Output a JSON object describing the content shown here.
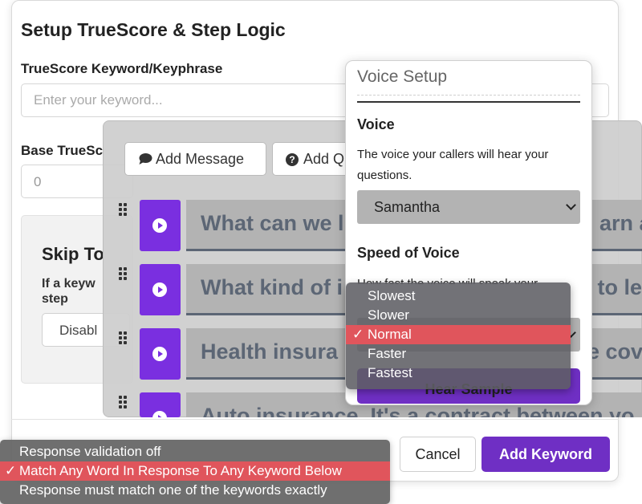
{
  "modal": {
    "title": "Setup TrueScore & Step Logic",
    "keyword_label": "TrueScore Keyword/Keyphrase",
    "keyword_placeholder": "Enter your keyword...",
    "base_label": "Base TrueSc",
    "base_value": "0",
    "skip_title": "Skip To",
    "skip_desc": "If a keyw step",
    "skip_select": "Disabl"
  },
  "footer": {
    "cancel_label": "Cancel",
    "add_keyword_label": "Add Keyword"
  },
  "validation_menu": {
    "options": [
      "Response validation off",
      "Match Any Word In Response To Any Keyword Below",
      "Response must match one of the keywords exactly"
    ],
    "selected": "Match Any Word In Response To Any Keyword Below",
    "check": "✓"
  },
  "messages_panel": {
    "add_message_label": "Add Message",
    "add_question_label": "Add Q",
    "question_icon": "?",
    "rows": [
      "What can we l",
      "What kind of i",
      "Health insura",
      "Auto insurance. It's a contract between yo"
    ],
    "row_suffixes": [
      "arn a",
      "e to le",
      "e cov",
      ""
    ]
  },
  "voice_setup": {
    "title": "Voice Setup",
    "voice_label": "Voice",
    "voice_desc": "The voice your callers will hear your questions.",
    "voice_selected": "Samantha",
    "speed_label": "Speed of Voice",
    "speed_desc": "How fast the voice will speak your",
    "hear_sample_label": "Hear Sample"
  },
  "speed_menu": {
    "options": [
      "Slowest",
      "Slower",
      "Normal",
      "Faster",
      "Fastest"
    ],
    "selected": "Normal",
    "check": "✓"
  },
  "colors": {
    "accent_purple": "#6f2fc4",
    "play_purple": "#7a2fe0",
    "selection_red": "#e0555c"
  }
}
